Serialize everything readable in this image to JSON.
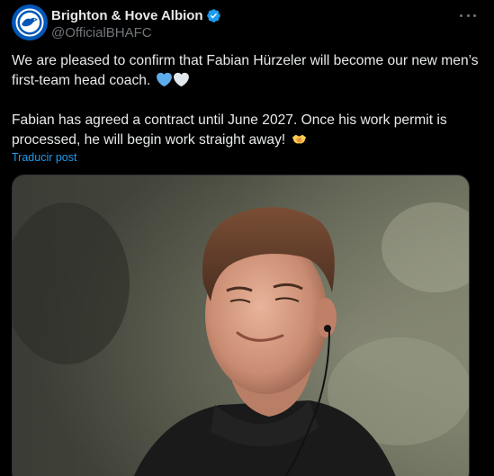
{
  "post": {
    "author_name": "Brighton & Hove Albion",
    "author_handle": "@OfficialBHAFC",
    "verified": true,
    "paragraph_1": "We are pleased to confirm that Fabian Hürzeler will become our new men’s first-team head coach.",
    "paragraph_2": "Fabian has agreed a contract until June 2027. Once his work permit is processed, he will begin work straight away!",
    "emojis_1": [
      "blue-heart-icon",
      "white-heart-icon"
    ],
    "emojis_2": [
      "handshake-icon"
    ],
    "translate_label": "Traducir post",
    "media_description_icon": "photo-icon"
  },
  "colors": {
    "background": "#000000",
    "text": "#e7e9ea",
    "muted": "#71767b",
    "link": "#1d9bf0",
    "verified": "#1d9bf0",
    "brand_blue": "#0057b8"
  }
}
